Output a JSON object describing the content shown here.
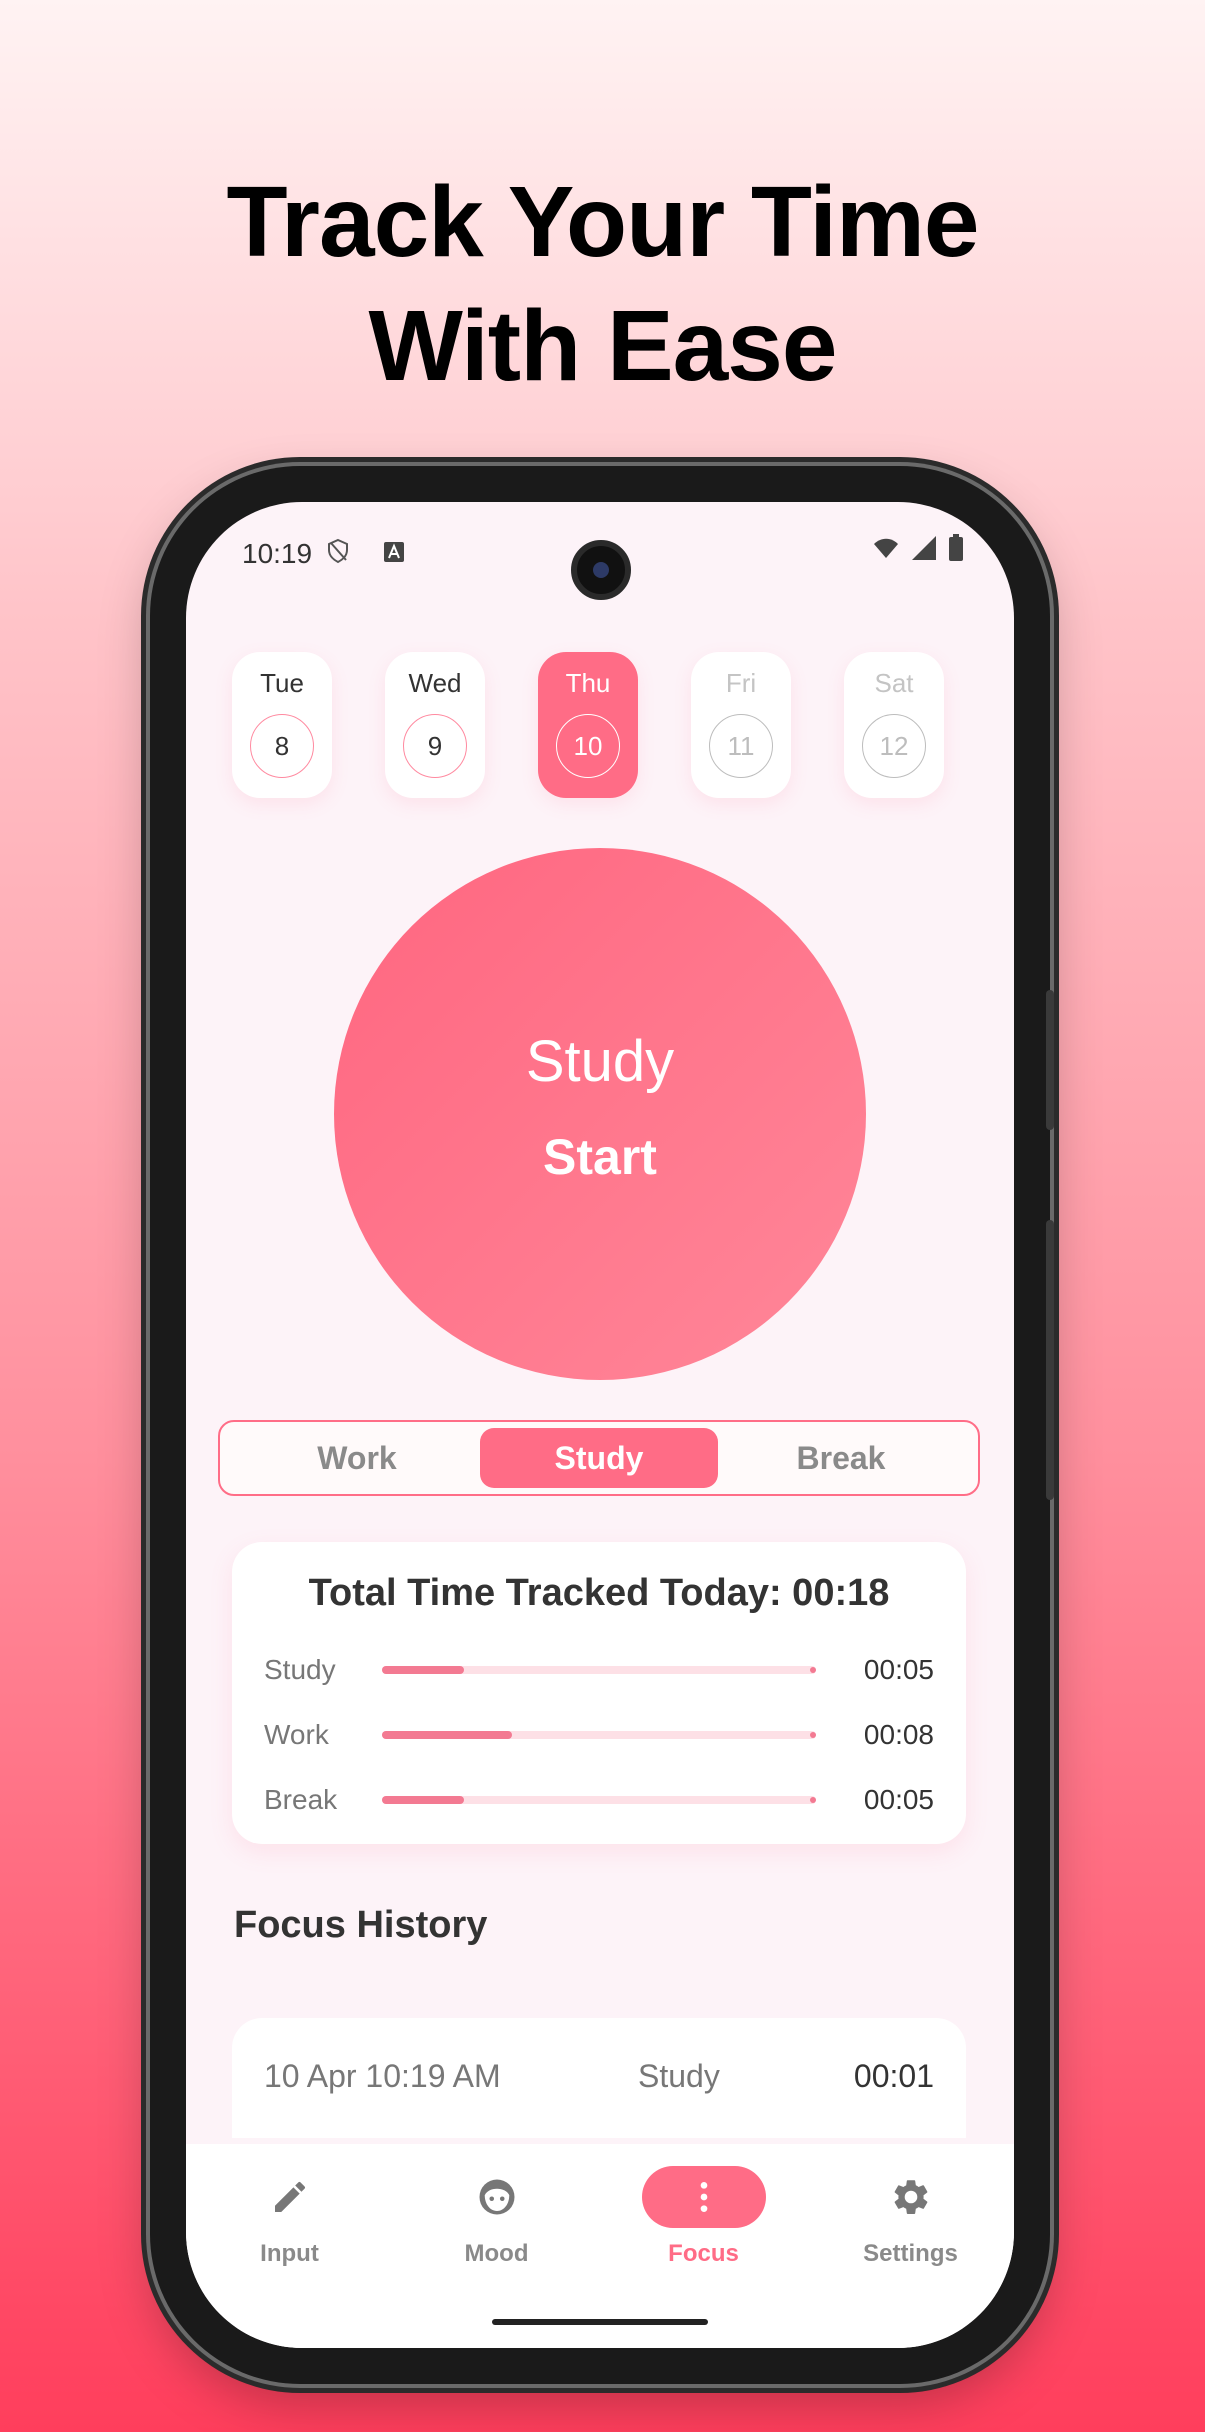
{
  "headline": {
    "line1": "Track Your Time",
    "line2": "With Ease"
  },
  "status_bar": {
    "time": "10:19",
    "icons": [
      "shield-icon",
      "a-badge-icon",
      "wifi-icon",
      "signal-icon",
      "battery-icon"
    ]
  },
  "days": [
    {
      "name": "Tue",
      "number": "8",
      "state": "past"
    },
    {
      "name": "Wed",
      "number": "9",
      "state": "past"
    },
    {
      "name": "Thu",
      "number": "10",
      "state": "active"
    },
    {
      "name": "Fri",
      "number": "11",
      "state": "future"
    },
    {
      "name": "Sat",
      "number": "12",
      "state": "future"
    }
  ],
  "timer": {
    "mode": "Study",
    "action": "Start"
  },
  "segments": {
    "work": "Work",
    "study": "Study",
    "break": "Break",
    "selected": "Study"
  },
  "summary": {
    "title": "Total Time Tracked Today: 00:18",
    "rows": [
      {
        "label": "Study",
        "value": "00:05",
        "fraction": 0.19
      },
      {
        "label": "Work",
        "value": "00:08",
        "fraction": 0.3
      },
      {
        "label": "Break",
        "value": "00:05",
        "fraction": 0.19
      }
    ]
  },
  "history": {
    "title": "Focus History",
    "items": [
      {
        "date": "10 Apr 10:19 AM",
        "type": "Study",
        "duration": "00:01"
      }
    ]
  },
  "nav": [
    {
      "label": "Input",
      "icon": "pencil-icon"
    },
    {
      "label": "Mood",
      "icon": "face-icon"
    },
    {
      "label": "Focus",
      "icon": "more-vertical-icon",
      "active": true
    },
    {
      "label": "Settings",
      "icon": "gear-icon"
    }
  ],
  "colors": {
    "accent": "#ff6c86",
    "screen_bg": "#fdf3f8",
    "text_dark": "#333333",
    "text_muted": "#8a8a8a"
  }
}
